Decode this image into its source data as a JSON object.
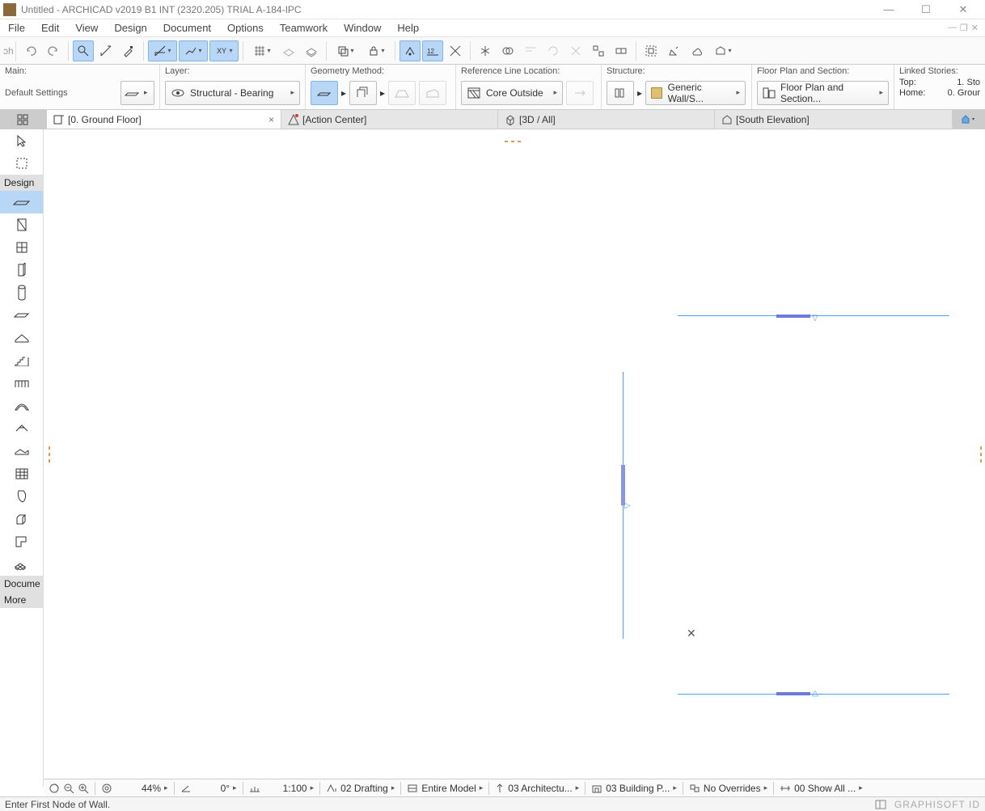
{
  "window": {
    "title": "Untitled - ARCHICAD v2019 B1 INT (2320.205) TRIAL A-184-IPC"
  },
  "menus": [
    "File",
    "Edit",
    "View",
    "Design",
    "Document",
    "Options",
    "Teamwork",
    "Window",
    "Help"
  ],
  "options": {
    "main": {
      "label": "Main:",
      "value": "Default Settings"
    },
    "layer": {
      "label": "Layer:",
      "value": "Structural - Bearing"
    },
    "geometry": {
      "label": "Geometry Method:"
    },
    "refline": {
      "label": "Reference Line Location:",
      "value": "Core Outside"
    },
    "structure": {
      "label": "Structure:",
      "value": "Generic Wall/S..."
    },
    "floorplan": {
      "label": "Floor Plan and Section:",
      "value": "Floor Plan and Section..."
    },
    "linked": {
      "label": "Linked Stories:",
      "top_k": "Top:",
      "top_v": "1. Sto",
      "home_k": "Home:",
      "home_v": "0. Grour"
    }
  },
  "tabs": {
    "t1": "[0. Ground Floor]",
    "t2": "[Action Center]",
    "t3": "[3D / All]",
    "t4": "[South Elevation]"
  },
  "toolbox": {
    "design": "Design",
    "docume": "Docume",
    "more": "More"
  },
  "quickbar": {
    "zoom": "44%",
    "angle": "0°",
    "scale": "1:100",
    "drafting": "02 Drafting",
    "model": "Entire Model",
    "arch": "03 Architectu...",
    "building": "03 Building P...",
    "overrides": "No Overrides",
    "showall": "00 Show All ..."
  },
  "status": {
    "hint": "Enter First Node of Wall.",
    "brand": "GRAPHISOFT ID"
  }
}
